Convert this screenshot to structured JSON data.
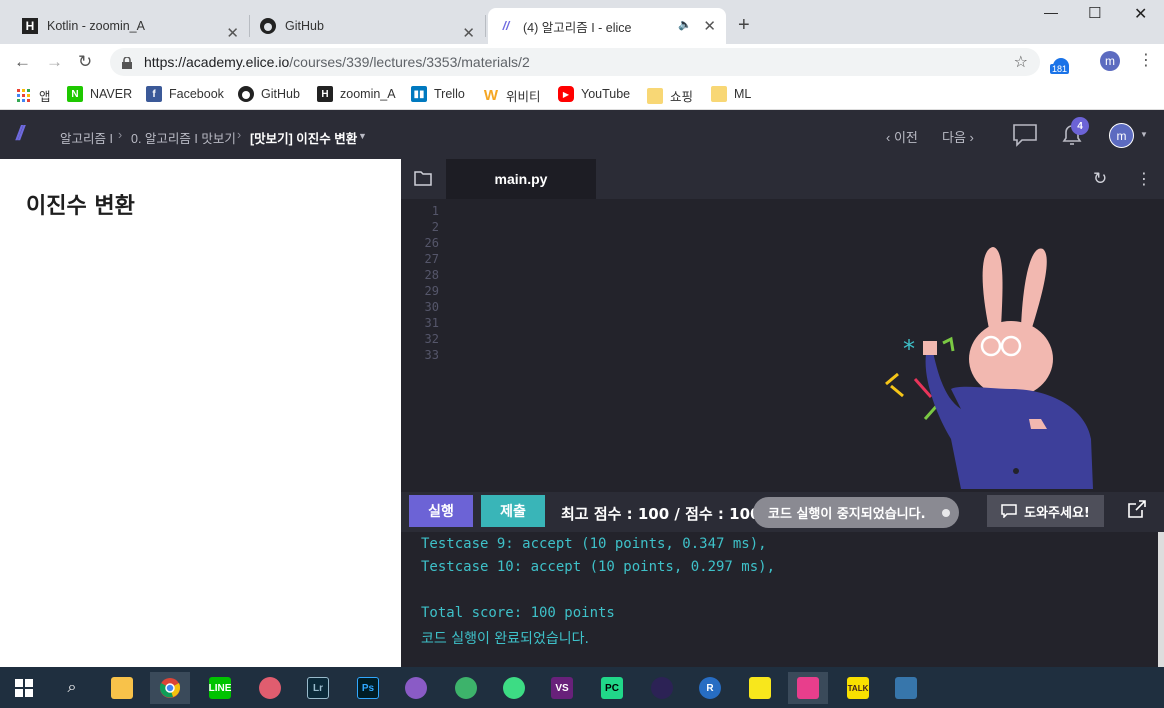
{
  "browser": {
    "tabs": [
      {
        "title": "Kotlin - zoomin_A",
        "favicon": "H"
      },
      {
        "title": "GitHub",
        "favicon": "github-icon"
      },
      {
        "title": "(4) 알고리즘 I - elice",
        "favicon": "elice-icon"
      }
    ],
    "url_host": "https://academy.elice.io",
    "url_path": "/courses/339/lectures/3353/materials/2",
    "extension_badge": "181",
    "profile_initial": "m"
  },
  "bookmarks": [
    {
      "label": "앱",
      "icon": "apps-grid-icon"
    },
    {
      "label": "NAVER",
      "icon": "naver-icon"
    },
    {
      "label": "Facebook",
      "icon": "facebook-icon"
    },
    {
      "label": "GitHub",
      "icon": "github-icon"
    },
    {
      "label": "zoomin_A",
      "icon": "H"
    },
    {
      "label": "Trello",
      "icon": "trello-icon"
    },
    {
      "label": "위비티",
      "icon": "W"
    },
    {
      "label": "YouTube",
      "icon": "youtube-icon"
    },
    {
      "label": "쇼핑",
      "icon": "folder-icon"
    },
    {
      "label": "ML",
      "icon": "folder-icon"
    }
  ],
  "elice": {
    "breadcrumb": [
      "알고리즘 I",
      "0. 알고리즘 I 맛보기",
      "[맛보기] 이진수 변환"
    ],
    "prev": "이전",
    "next": "다음",
    "notif_count": "4",
    "avatar": "m"
  },
  "lesson": {
    "title": "이진수 변환"
  },
  "editor": {
    "file_tab": "main.py",
    "line_numbers": [
      "1",
      "2",
      "26",
      "27",
      "28",
      "29",
      "30",
      "31",
      "32",
      "33"
    ]
  },
  "toolbar": {
    "run": "실행",
    "submit": "제출",
    "score": "최고 점수 : 100 / 점수 : 100",
    "toast": "코드 실행이 중지되었습니다.",
    "help": "도와주세요!"
  },
  "output": [
    "Testcase 9: accept (10 points, 0.347 ms),",
    "Testcase 10: accept (10 points, 0.297 ms),",
    "",
    "Total score: 100 points",
    "코드 실행이 완료되었습니다."
  ],
  "taskbar": [
    "start-icon",
    "search-icon",
    "file-explorer-icon",
    "chrome-icon",
    "line-icon",
    "pinwheel-icon",
    "lightroom-icon",
    "photoshop-icon",
    "github-desktop-icon",
    "atom-icon",
    "android-studio-icon",
    "visual-studio-icon",
    "pycharm-icon",
    "eclipse-icon",
    "r-icon",
    "sticky-notes-icon",
    "gitkraken-icon",
    "kakaotalk-icon",
    "python-icon"
  ],
  "colors": {
    "run": "#6c63d6",
    "submit": "#39b5b8",
    "header": "#2b2c36",
    "editor": "#23232b",
    "output_text": "#3ec1c9"
  }
}
